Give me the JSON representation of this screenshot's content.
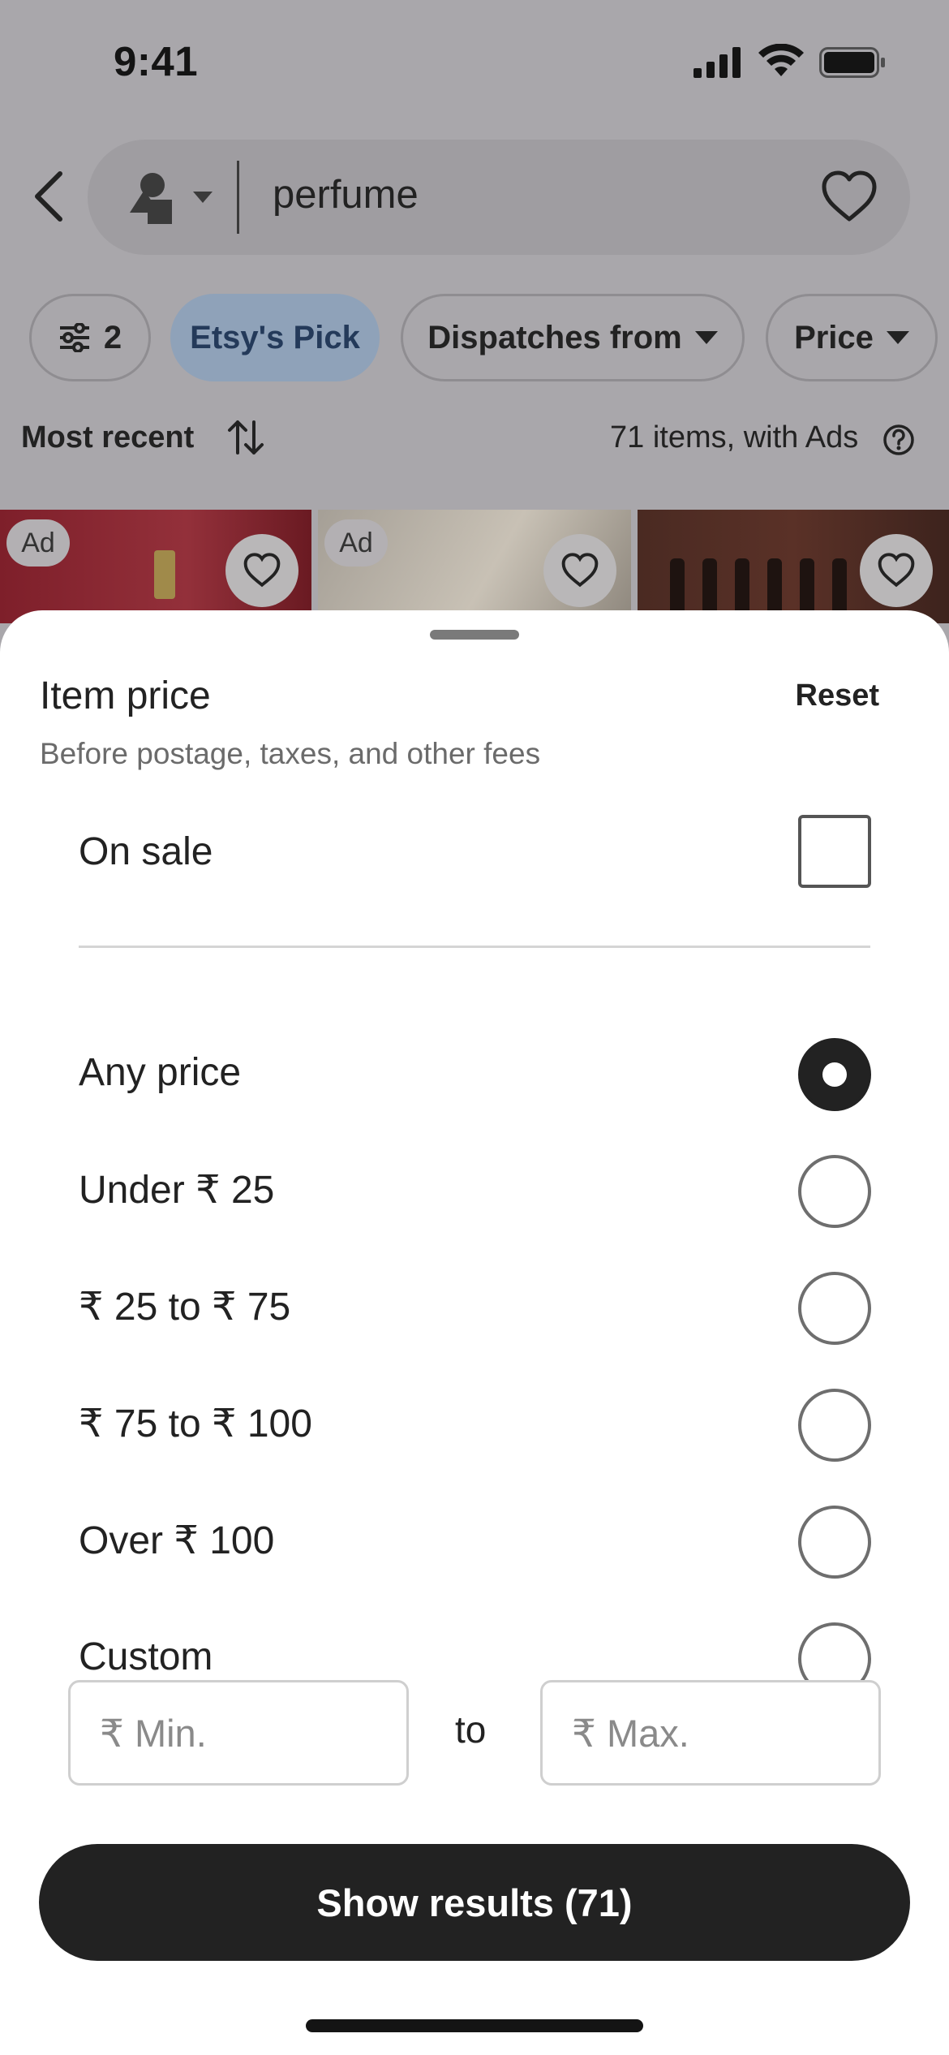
{
  "status_bar": {
    "time": "9:41"
  },
  "search": {
    "query": "perfume"
  },
  "filters": {
    "count": "2",
    "chips": [
      "Etsy's Pick",
      "Dispatches from",
      "Price"
    ]
  },
  "sort": {
    "label": "Most recent",
    "items_count": "71 items, with Ads"
  },
  "listings": {
    "ad_label": "Ad"
  },
  "sheet": {
    "title": "Item price",
    "subtitle": "Before postage, taxes, and other fees",
    "reset_label": "Reset",
    "on_sale_label": "On sale",
    "on_sale_checked": false,
    "options": [
      {
        "label": "Any price",
        "selected": true
      },
      {
        "label": "Under ₹ 25",
        "selected": false
      },
      {
        "label": "₹ 25 to ₹ 75",
        "selected": false
      },
      {
        "label": "₹ 75 to ₹ 100",
        "selected": false
      },
      {
        "label": "Over ₹ 100",
        "selected": false
      },
      {
        "label": "Custom",
        "selected": false
      }
    ],
    "min_placeholder": "₹ Min.",
    "max_placeholder": "₹ Max.",
    "to_label": "to",
    "show_results_label": "Show results (71)"
  },
  "colors": {
    "accent_dark": "#222222",
    "chip_highlight": "#8fa2b9",
    "overlay": "#a9a7ab"
  }
}
